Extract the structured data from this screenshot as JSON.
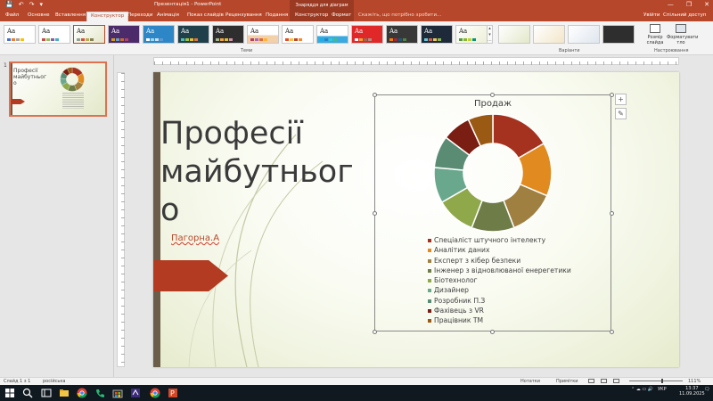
{
  "window": {
    "title": "Презентація1 - PowerPoint",
    "context_title": "Знаряддя для діаграм",
    "min": "—",
    "max": "❐",
    "close": "✕"
  },
  "qat": {
    "save": "💾",
    "undo": "↶",
    "redo": "↷",
    "more": "▾"
  },
  "tabs": [
    {
      "label": "Файл"
    },
    {
      "label": "Основне"
    },
    {
      "label": "Вставлення"
    },
    {
      "label": "Конструктор"
    },
    {
      "label": "Переходи"
    },
    {
      "label": "Анімація"
    },
    {
      "label": "Показ слайдів"
    },
    {
      "label": "Рецензування"
    },
    {
      "label": "Подання"
    },
    {
      "label": "Конструктор"
    },
    {
      "label": "Формат"
    }
  ],
  "tell_me": "Скажіть, що потрібно зробити...",
  "sign_in": "Увійти",
  "share": "Спільний доступ",
  "ribbon": {
    "theme_label": "Теми",
    "variants_label": "Варіанти",
    "customize_label": "Настроювання",
    "theme_glyph": "Aa",
    "slide_size": "Розмір слайда",
    "format_bg": "Форматувати тло"
  },
  "thumbnail": {
    "number": "1",
    "title": "Професії майбутньог о"
  },
  "slide": {
    "title": "Професії майбутньог о",
    "subtitle": "Пагорна.А"
  },
  "chart_data": {
    "type": "pie",
    "title": "Продаж",
    "categories": [
      "Спеціаліст штучного інтелекту",
      "Аналітик даних",
      "Експерт з кібер безпеки",
      "Інженер з відновлюваної енерегетики",
      "Біотехнолог",
      "Дизайнер",
      "Розробник П.З",
      "Фахівець з VR",
      "Працівник ТМ"
    ],
    "values": [
      17,
      15,
      13,
      12,
      11,
      10,
      9,
      8,
      7
    ],
    "colors": [
      "#a5321f",
      "#e08a20",
      "#a08040",
      "#6e7d48",
      "#8ea84a",
      "#6aa88e",
      "#5a8b73",
      "#7a1d12",
      "#9b5a14"
    ],
    "donut": true,
    "legend": "bottom"
  },
  "status": {
    "slide": "Слайд 1 з 1",
    "lang": "російська",
    "notes": "Нотатки",
    "comments": "Примітки",
    "zoom": "111%"
  },
  "taskbar": {
    "time": "13:37",
    "date": "11.09.2025",
    "lang": "УКР"
  }
}
